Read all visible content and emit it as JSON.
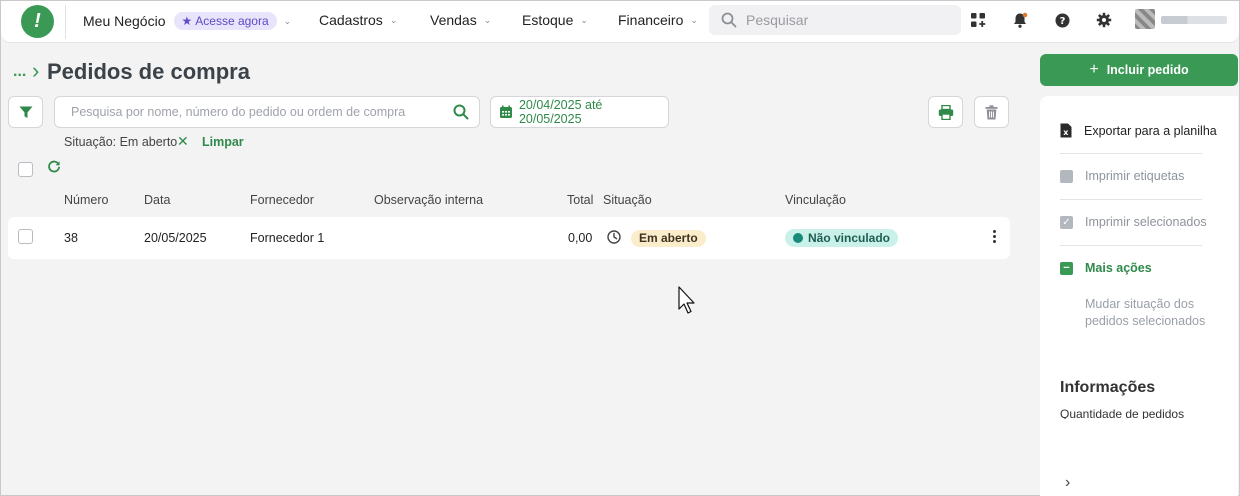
{
  "nav": {
    "business": "Meu Negócio",
    "badge": "Acesse agora",
    "items": [
      "Cadastros",
      "Vendas",
      "Estoque",
      "Financeiro"
    ],
    "search_placeholder": "Pesquisar"
  },
  "page": {
    "crumb": "...",
    "title": "Pedidos de compra"
  },
  "filters": {
    "search_placeholder": "Pesquisa por nome, número do pedido ou ordem de compra",
    "date_range": "20/04/2025 até 20/05/2025",
    "chip": "Situação: Em aberto",
    "clear": "Limpar"
  },
  "table": {
    "headers": [
      "Número",
      "Data",
      "Fornecedor",
      "Observação interna",
      "Total",
      "Situação",
      "Vinculação"
    ],
    "rows": [
      {
        "numero": "38",
        "data": "20/05/2025",
        "fornecedor": "Fornecedor 1",
        "obs": "",
        "total": "0,00",
        "situacao": "Em aberto",
        "vinculacao": "Não vinculado"
      }
    ]
  },
  "panel": {
    "primary": "Incluir pedido",
    "export": "Exportar para a planilha",
    "print_labels": "Imprimir etiquetas",
    "print_selected": "Imprimir selecionados",
    "more": "Mais ações",
    "change_status": "Mudar situação dos pedidos selecionados",
    "info_title": "Informações",
    "info_sub": "Quantidade de pedidos"
  },
  "colors": {
    "brand": "#3a9a55",
    "status_open": "#fbeccc",
    "link_status": "#c9f1e9"
  }
}
